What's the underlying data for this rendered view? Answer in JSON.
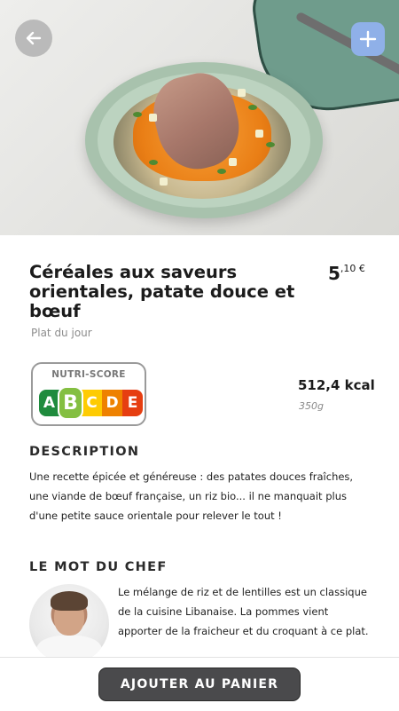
{
  "product": {
    "title": "Céréales aux saveurs orientales, patate douce et bœuf",
    "subtitle": "Plat du jour",
    "price_euros": "5",
    "price_cents": ",10 €"
  },
  "nutriscore": {
    "label": "NUTRI-SCORE",
    "grades": [
      {
        "letter": "A",
        "color": "#1f8b3d"
      },
      {
        "letter": "B",
        "color": "#84bf41"
      },
      {
        "letter": "C",
        "color": "#fecb02"
      },
      {
        "letter": "D",
        "color": "#ee8100"
      },
      {
        "letter": "E",
        "color": "#e63e11"
      }
    ],
    "active_grade": "B"
  },
  "nutrition": {
    "kcal": "512,4 kcal",
    "weight": "350g"
  },
  "description": {
    "heading": "DESCRIPTION",
    "text": "Une recette épicée et généreuse : des patates douces fraîches, une viande de bœuf française, un riz bio... il ne manquait plus d'une petite sauce orientale pour relever le tout !"
  },
  "chef": {
    "heading": "LE MOT DU CHEF",
    "text": "Le mélange de riz et de lentilles est un classique de la cuisine Libanaise. La pommes vient apporter de la fraicheur et du croquant à ce plat."
  },
  "actions": {
    "add_to_cart": "AJOUTER AU PANIER"
  },
  "icons": {
    "back": "arrow-left-icon",
    "add": "plus-icon"
  },
  "colors": {
    "cta_background": "#4a4a4c",
    "add_button": "#8fb0e8"
  }
}
